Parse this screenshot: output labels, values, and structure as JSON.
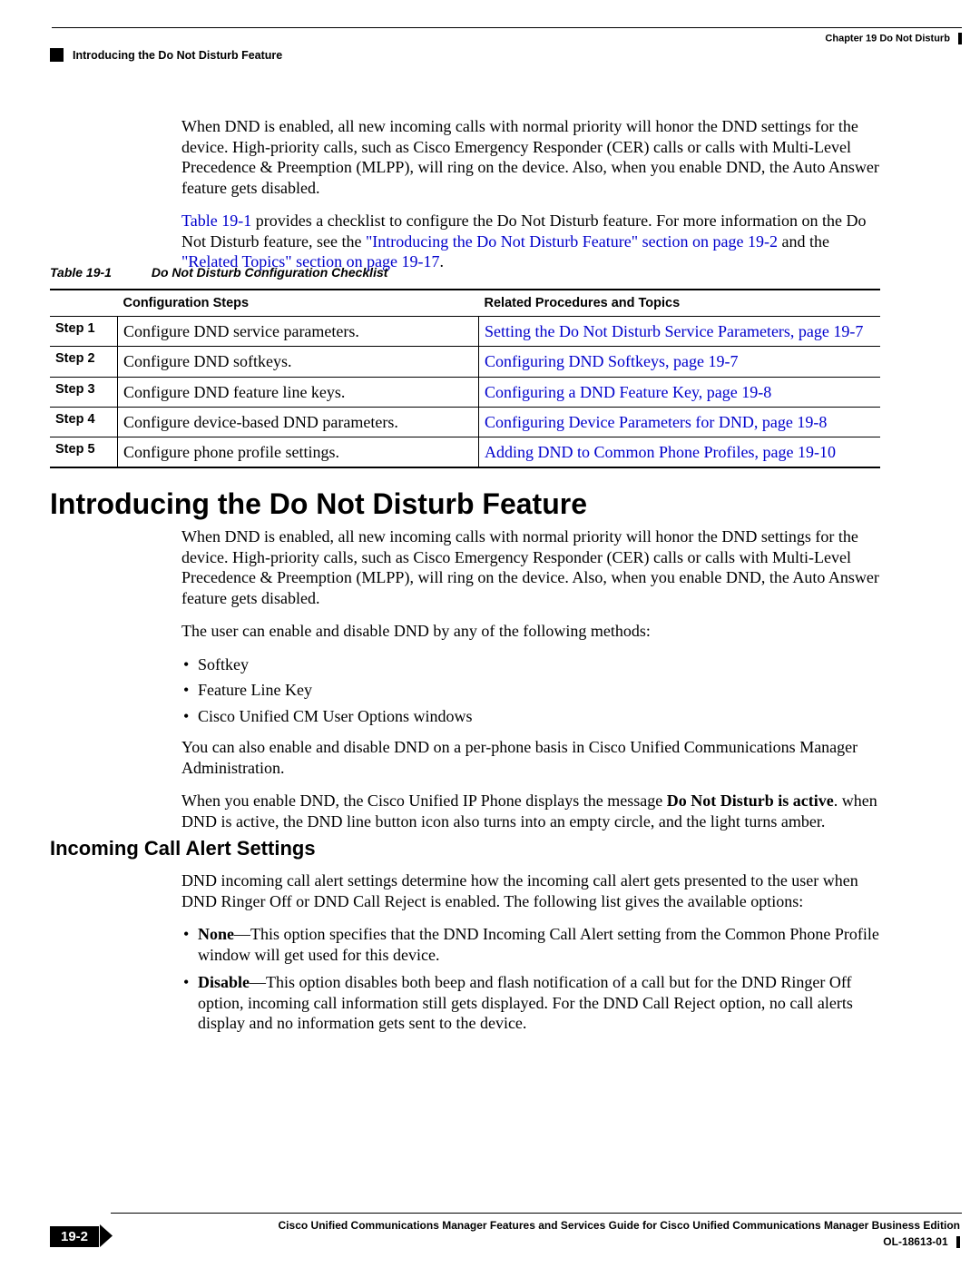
{
  "header": {
    "chapter": "Chapter 19    Do Not Disturb",
    "section": "Introducing the Do Not Disturb Feature"
  },
  "intro": {
    "p1": "When DND is enabled, all new incoming calls with normal priority will honor the DND settings for the device. High-priority calls, such as Cisco Emergency Responder (CER) calls or calls with Multi-Level Precedence & Preemption (MLPP), will ring on the device. Also, when you enable DND, the Auto Answer feature gets disabled.",
    "p2a": "Table 19-1",
    "p2b": " provides a checklist to configure the Do Not Disturb feature. For more information on the Do Not Disturb feature, see the ",
    "p2c": "\"Introducing the Do Not Disturb Feature\" section on page 19-2",
    "p2d": " and the ",
    "p2e": "\"Related Topics\" section on page 19-17",
    "p2f": "."
  },
  "table": {
    "caption_num": "Table 19-1",
    "caption_title": "Do Not Disturb Configuration Checklist",
    "col1": "",
    "col2": "Configuration Steps",
    "col3": "Related Procedures and Topics",
    "rows": [
      {
        "step": "Step 1",
        "config": "Configure DND service parameters.",
        "link": "Setting the Do Not Disturb Service Parameters, page 19-7"
      },
      {
        "step": "Step 2",
        "config": "Configure DND softkeys.",
        "link": "Configuring DND Softkeys, page 19-7"
      },
      {
        "step": "Step 3",
        "config": "Configure DND feature line keys.",
        "link": "Configuring a DND Feature Key, page 19-8"
      },
      {
        "step": "Step 4",
        "config": "Configure device-based DND parameters.",
        "link": "Configuring Device Parameters for DND, page 19-8"
      },
      {
        "step": "Step 5",
        "config": "Configure phone profile settings.",
        "link": "Adding DND to Common Phone Profiles, page 19-10"
      }
    ]
  },
  "section_intro": {
    "heading": "Introducing the Do Not Disturb Feature",
    "p1": "When DND is enabled, all new incoming calls with normal priority will honor the DND settings for the device. High-priority calls, such as Cisco Emergency Responder (CER) calls or calls with Multi-Level Precedence & Preemption (MLPP), will ring on the device. Also, when you enable DND, the Auto Answer feature gets disabled.",
    "p2": "The user can enable and disable DND by any of the following methods:",
    "bullets": [
      "Softkey",
      "Feature Line Key",
      "Cisco Unified CM User Options windows"
    ],
    "p3": "You can also enable and disable DND on a per-phone basis in Cisco Unified Communications Manager Administration.",
    "p4a": "When you enable DND, the Cisco Unified IP Phone displays the message ",
    "p4b": "Do Not Disturb is active",
    "p4c": ". when DND is active, the DND line button icon also turns into an empty circle, and the light turns amber."
  },
  "section_alert": {
    "heading": "Incoming Call Alert Settings",
    "p1": "DND incoming call alert settings determine how the incoming call alert gets presented to the user when DND Ringer Off or DND Call Reject is enabled. The following list gives the available options:",
    "b1a": "None",
    "b1b": "—This option specifies that the DND Incoming Call Alert setting from the Common Phone Profile window will get used for this device.",
    "b2a": "Disable",
    "b2b": "—This option disables both beep and flash notification of a call but for the DND Ringer Off option, incoming call information still gets displayed. For the DND Call Reject option, no call alerts display and no information gets sent to the device."
  },
  "footer": {
    "title": "Cisco Unified Communications Manager Features and Services Guide for Cisco Unified Communications Manager Business Edition",
    "doc": "OL-18613-01",
    "page": "19-2"
  }
}
